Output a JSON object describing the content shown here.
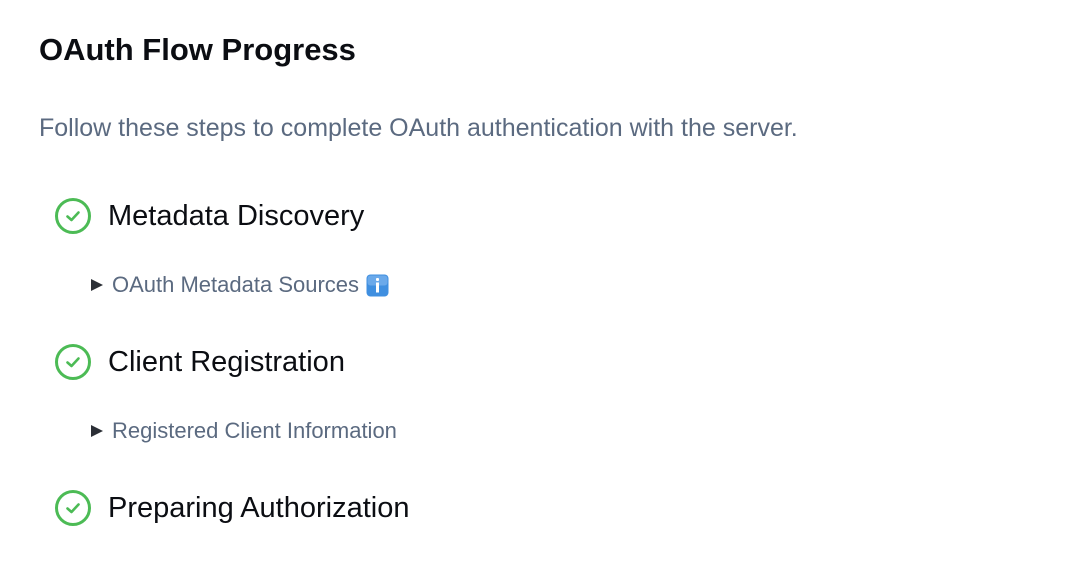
{
  "header": {
    "title": "OAuth Flow Progress",
    "subtitle": "Follow these steps to complete OAuth authentication with the server."
  },
  "steps": [
    {
      "label": "Metadata Discovery",
      "status": "complete",
      "icon": "check-circle-icon",
      "details_label": "OAuth Metadata Sources",
      "details_icon": "info-icon"
    },
    {
      "label": "Client Registration",
      "status": "complete",
      "icon": "check-circle-icon",
      "details_label": "Registered Client Information"
    },
    {
      "label": "Preparing Authorization",
      "status": "complete",
      "icon": "check-circle-icon"
    }
  ],
  "colors": {
    "complete": "#4cbb55",
    "muted_text": "#5b6a80",
    "info_badge": "#3f8fe0"
  }
}
